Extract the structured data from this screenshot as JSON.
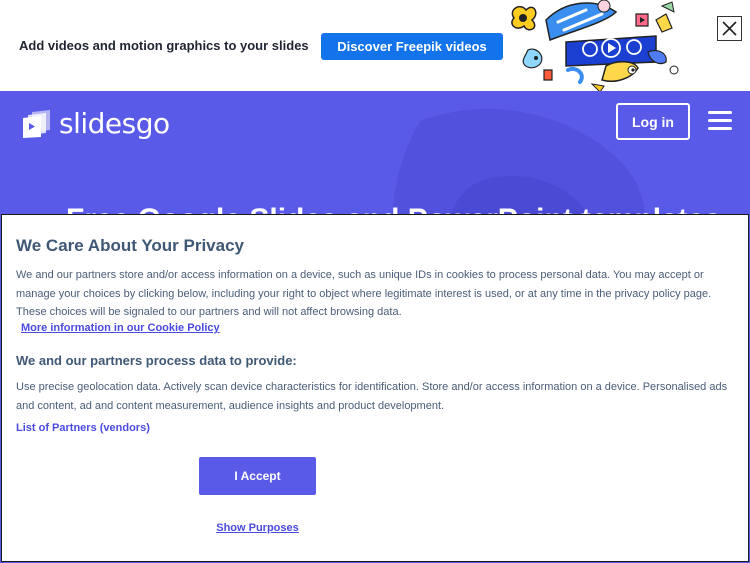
{
  "promo": {
    "text": "Add videos and motion graphics to your slides",
    "button_label": "Discover Freepik videos",
    "close_icon": "close-icon",
    "button_color": "#1273eb"
  },
  "header": {
    "logo_text": "slidesgo",
    "login_label": "Log in",
    "menu_icon": "hamburger-menu-icon",
    "headline_partial": "Free Google Slides and PowerPoint templates",
    "background_color": "#5a5ae8"
  },
  "privacy_modal": {
    "title": "We Care About Your Privacy",
    "body": "We and our partners store and/or access information on a device, such as unique IDs in cookies to process personal data. You may accept or manage your choices by clicking below, including your right to object where legitimate interest is used, or at any time in the privacy policy page. These choices will be signaled to our partners and will not affect browsing data.",
    "cookie_policy_link": "More information in our Cookie Policy",
    "subheading": "We and our partners process data to provide:",
    "purposes": "Use precise geolocation data. Actively scan device characteristics for identification. Store and/or access information on a device. Personalised ads and content, ad and content measurement, audience insights and product development.",
    "partners_link": "List of Partners (vendors)",
    "accept_label": "I Accept",
    "show_purposes_label": "Show Purposes",
    "accent_color": "#5a5ae8"
  }
}
